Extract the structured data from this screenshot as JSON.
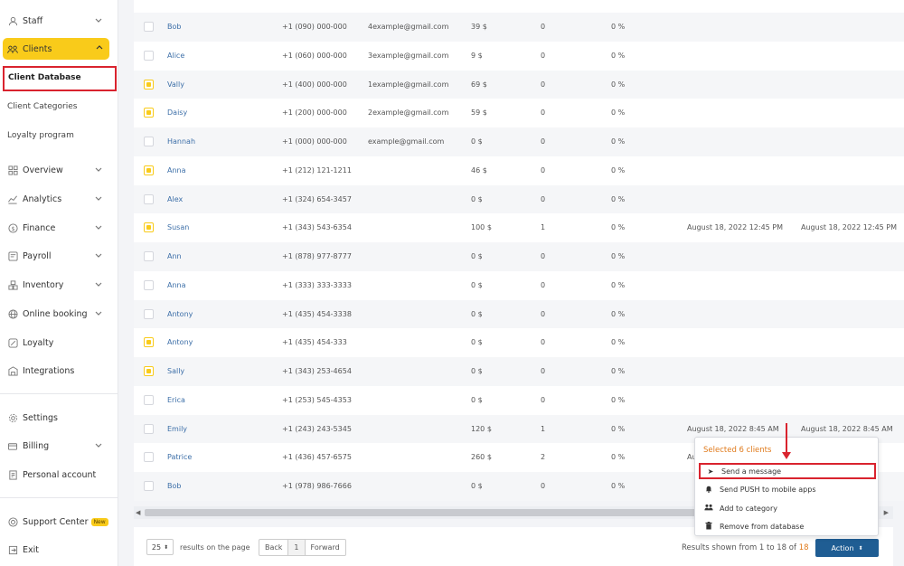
{
  "sidebar": {
    "staff": "Staff",
    "clients": "Clients",
    "client_database": "Client Database",
    "client_categories": "Client Categories",
    "loyalty_program": "Loyalty program",
    "overview": "Overview",
    "analytics": "Analytics",
    "finance": "Finance",
    "payroll": "Payroll",
    "inventory": "Inventory",
    "online_booking": "Online booking",
    "loyalty": "Loyalty",
    "integrations": "Integrations",
    "settings": "Settings",
    "billing": "Billing",
    "personal_account": "Personal account",
    "support_center": "Support Center",
    "support_badge": "New",
    "exit": "Exit"
  },
  "rows": [
    {
      "name": "Bob",
      "phone": "+1 (090) 000-000",
      "email": "4example@gmail.com",
      "sum": "39 $",
      "visits": "0",
      "discount": "0 %",
      "first": "",
      "last": "",
      "checked": false
    },
    {
      "name": "Alice",
      "phone": "+1 (060) 000-000",
      "email": "3example@gmail.com",
      "sum": "9 $",
      "visits": "0",
      "discount": "0 %",
      "first": "",
      "last": "",
      "checked": false
    },
    {
      "name": "Vally",
      "phone": "+1 (400) 000-000",
      "email": "1example@gmail.com",
      "sum": "69 $",
      "visits": "0",
      "discount": "0 %",
      "first": "",
      "last": "",
      "checked": true
    },
    {
      "name": "Daisy",
      "phone": "+1 (200) 000-000",
      "email": "2example@gmail.com",
      "sum": "59 $",
      "visits": "0",
      "discount": "0 %",
      "first": "",
      "last": "",
      "checked": true
    },
    {
      "name": "Hannah",
      "phone": "+1 (000) 000-000",
      "email": "example@gmail.com",
      "sum": "0 $",
      "visits": "0",
      "discount": "0 %",
      "first": "",
      "last": "",
      "checked": false
    },
    {
      "name": "Anna",
      "phone": "+1 (212) 121-1211",
      "email": "",
      "sum": "46 $",
      "visits": "0",
      "discount": "0 %",
      "first": "",
      "last": "",
      "checked": true
    },
    {
      "name": "Alex",
      "phone": "+1 (324) 654-3457",
      "email": "",
      "sum": "0 $",
      "visits": "0",
      "discount": "0 %",
      "first": "",
      "last": "",
      "checked": false
    },
    {
      "name": "Susan",
      "phone": "+1 (343) 543-6354",
      "email": "",
      "sum": "100 $",
      "visits": "1",
      "discount": "0 %",
      "first": "August 18, 2022 12:45 PM",
      "last": "August 18, 2022 12:45 PM",
      "checked": true
    },
    {
      "name": "Ann",
      "phone": "+1 (878) 977-8777",
      "email": "",
      "sum": "0 $",
      "visits": "0",
      "discount": "0 %",
      "first": "",
      "last": "",
      "checked": false
    },
    {
      "name": "Anna",
      "phone": "+1 (333) 333-3333",
      "email": "",
      "sum": "0 $",
      "visits": "0",
      "discount": "0 %",
      "first": "",
      "last": "",
      "checked": false
    },
    {
      "name": "Antony",
      "phone": "+1 (435) 454-3338",
      "email": "",
      "sum": "0 $",
      "visits": "0",
      "discount": "0 %",
      "first": "",
      "last": "",
      "checked": false
    },
    {
      "name": "Antony",
      "phone": "+1 (435) 454-333",
      "email": "",
      "sum": "0 $",
      "visits": "0",
      "discount": "0 %",
      "first": "",
      "last": "",
      "checked": true
    },
    {
      "name": "Sally",
      "phone": "+1 (343) 253-4654",
      "email": "",
      "sum": "0 $",
      "visits": "0",
      "discount": "0 %",
      "first": "",
      "last": "",
      "checked": true
    },
    {
      "name": "Erica",
      "phone": "+1 (253) 545-4353",
      "email": "",
      "sum": "0 $",
      "visits": "0",
      "discount": "0 %",
      "first": "",
      "last": "",
      "checked": false
    },
    {
      "name": "Emily",
      "phone": "+1 (243) 243-5345",
      "email": "",
      "sum": "120 $",
      "visits": "1",
      "discount": "0 %",
      "first": "August 18, 2022 8:45 AM",
      "last": "August 18, 2022 8:45 AM",
      "checked": false
    },
    {
      "name": "Patrice",
      "phone": "+1 (436) 457-6575",
      "email": "",
      "sum": "260 $",
      "visits": "2",
      "discount": "0 %",
      "first": "Au",
      "last": "",
      "checked": false
    },
    {
      "name": "Bob",
      "phone": "+1 (978) 986-7666",
      "email": "",
      "sum": "0 $",
      "visits": "0",
      "discount": "0 %",
      "first": "",
      "last": "",
      "checked": false
    }
  ],
  "footer": {
    "per_page": "25",
    "per_page_label": "results on the page",
    "back": "Back",
    "page": "1",
    "forward": "Forward",
    "results_prefix": "Results shown from 1 to 18 of",
    "results_total": "18",
    "action": "Action"
  },
  "dropdown": {
    "header": "Selected 6 clients",
    "items": [
      "Send a message",
      "Send PUSH to mobile apps",
      "Add to category",
      "Remove from database"
    ]
  },
  "colors": {
    "accent": "#f9cb1a",
    "action_button": "#1f5d93",
    "link": "#3d6fa8",
    "highlight": "#d9232e",
    "count": "#e07a1b"
  }
}
